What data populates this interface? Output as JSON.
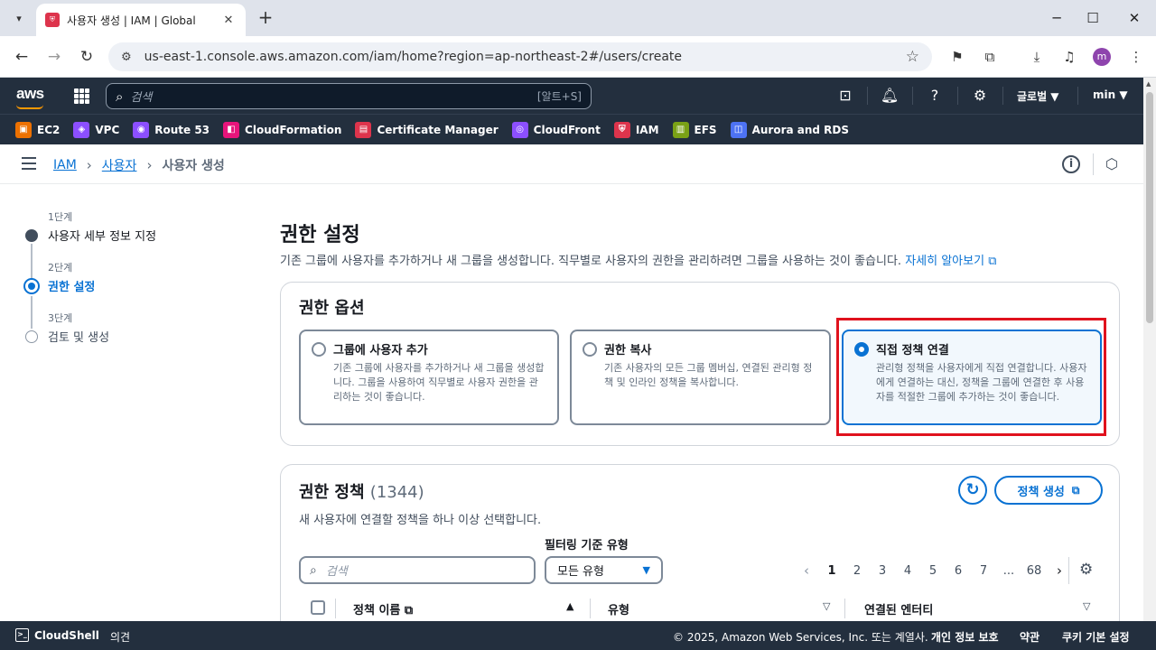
{
  "browser": {
    "tab_title": "사용자 생성 | IAM | Global",
    "url": "us-east-1.console.aws.amazon.com/iam/home?region=ap-northeast-2#/users/create",
    "profile_letter": "m"
  },
  "aws_header": {
    "logo": "aws",
    "search_placeholder": "검색",
    "search_shortcut": "[알트+S]",
    "region_menu": "글로벌 ▼",
    "user_menu": "min ▼"
  },
  "favorites": [
    {
      "label": "EC2",
      "color": "#ed7100",
      "icon": "ec2-icon"
    },
    {
      "label": "VPC",
      "color": "#8c4fff",
      "icon": "vpc-icon"
    },
    {
      "label": "Route 53",
      "color": "#8c4fff",
      "icon": "route53-icon"
    },
    {
      "label": "CloudFormation",
      "color": "#e7157b",
      "icon": "cloudformation-icon"
    },
    {
      "label": "Certificate Manager",
      "color": "#dd344c",
      "icon": "certificate-manager-icon"
    },
    {
      "label": "CloudFront",
      "color": "#8c4fff",
      "icon": "cloudfront-icon"
    },
    {
      "label": "IAM",
      "color": "#dd344c",
      "icon": "iam-icon"
    },
    {
      "label": "EFS",
      "color": "#7aa116",
      "icon": "efs-icon"
    },
    {
      "label": "Aurora and RDS",
      "color": "#4d72f3",
      "icon": "rds-icon"
    }
  ],
  "breadcrumb": {
    "root": "IAM",
    "parent": "사용자",
    "current": "사용자 생성"
  },
  "steps": [
    {
      "num": "1단계",
      "name": "사용자 세부 정보 지정",
      "state": "done"
    },
    {
      "num": "2단계",
      "name": "권한 설정",
      "state": "active"
    },
    {
      "num": "3단계",
      "name": "검토 및 생성",
      "state": "todo"
    }
  ],
  "main": {
    "title": "권한 설정",
    "description": "기존 그룹에 사용자를 추가하거나 새 그룹을 생성합니다. 직무별로 사용자의 권한을 관리하려면 그룹을 사용하는 것이 좋습니다.",
    "learn_more": "자세히 알아보기"
  },
  "options_panel": {
    "title": "권한 옵션",
    "options": [
      {
        "title": "그룹에 사용자 추가",
        "desc": "기존 그룹에 사용자를 추가하거나 새 그룹을 생성합니다. 그룹을 사용하여 직무별로 사용자 권한을 관리하는 것이 좋습니다.",
        "selected": false
      },
      {
        "title": "권한 복사",
        "desc": "기존 사용자의 모든 그룹 멤버십, 연결된 관리형 정책 및 인라인 정책을 복사합니다.",
        "selected": false
      },
      {
        "title": "직접 정책 연결",
        "desc": "관리형 정책을 사용자에게 직접 연결합니다. 사용자에게 연결하는 대신, 정책을 그룹에 연결한 후 사용자를 적절한 그룹에 추가하는 것이 좋습니다.",
        "selected": true
      }
    ]
  },
  "policies_panel": {
    "title": "권한 정책",
    "count": "(1344)",
    "create_button": "정책 생성",
    "description": "새 사용자에 연결할 정책을 하나 이상 선택합니다.",
    "filter_label": "필터링 기준 유형",
    "search_placeholder": "검색",
    "filter_value": "모든 유형",
    "pages": [
      "1",
      "2",
      "3",
      "4",
      "5",
      "6",
      "7",
      "...",
      "68"
    ],
    "current_page": "1",
    "columns": [
      "정책 이름",
      "유형",
      "연결된 엔터티"
    ]
  },
  "footer": {
    "cloudshell": "CloudShell",
    "feedback": "의견",
    "copyright": "© 2025, Amazon Web Services, Inc. 또는 계열사.",
    "privacy": "개인 정보 보호",
    "terms": "약관",
    "cookies": "쿠키 기본 설정"
  }
}
